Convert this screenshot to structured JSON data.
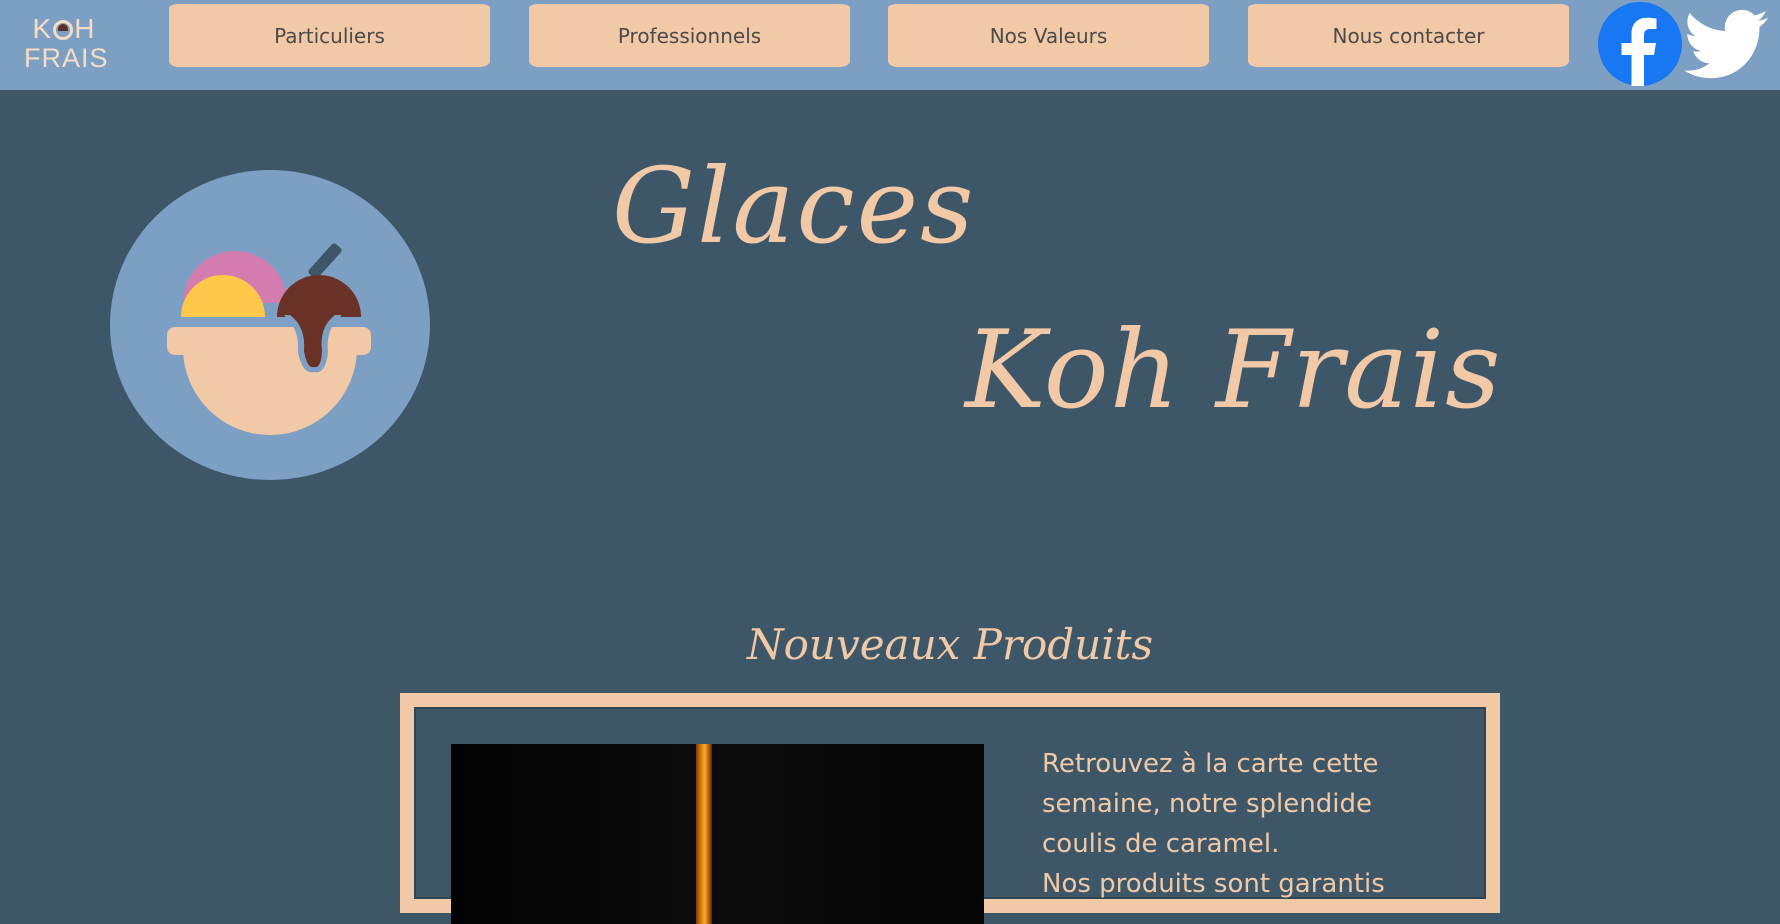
{
  "header": {
    "logo": {
      "line1_left": "K",
      "line1_right": "H",
      "line2": "FRAIS"
    },
    "nav": [
      {
        "label": "Particuliers"
      },
      {
        "label": "Professionnels"
      },
      {
        "label": "Nos Valeurs"
      },
      {
        "label": "Nous contacter"
      }
    ],
    "social": [
      {
        "icon": "facebook-icon",
        "color": "#1877f2"
      },
      {
        "icon": "twitter-icon",
        "color": "#ffffff"
      }
    ]
  },
  "hero": {
    "logo_icon": "ice-cream-bowl-icon",
    "title_line1": "Glaces",
    "title_line2": "Koh Frais"
  },
  "products": {
    "title": "Nouveaux Produits",
    "image_icon": "caramel-drip-image",
    "description_lines": [
      "Retrouvez à la carte cette",
      "semaine, notre splendide",
      "coulis de caramel.",
      "Nos produits sont garantis"
    ]
  },
  "colors": {
    "navbar_bg": "#7e9fc4",
    "page_bg": "#3d5769",
    "accent_peach": "#f2c9a6"
  }
}
